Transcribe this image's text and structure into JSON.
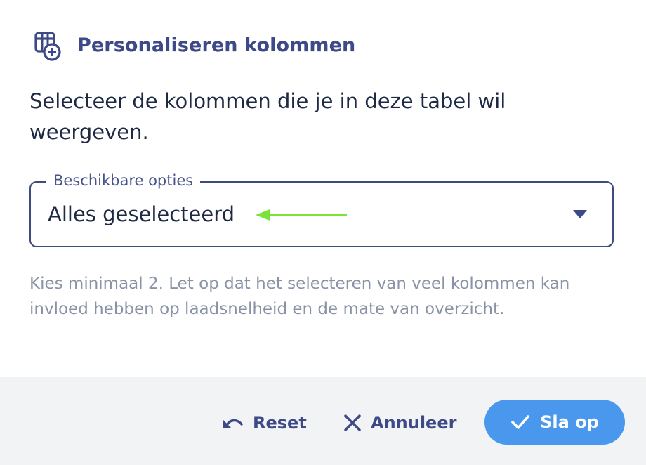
{
  "dialog": {
    "title": "Personaliseren kolommen",
    "title_icon": "table-add-icon",
    "description": "Selecteer de kolommen die je in deze tabel wil weergeven."
  },
  "select": {
    "legend": "Beschikbare opties",
    "value": "Alles geselecteerd",
    "caret_icon": "caret-down-icon",
    "annotation_color": "#7be23a"
  },
  "helper_text": "Kies minimaal 2. Let op dat het selecteren van veel kolommen kan invloed hebben op laadsnelheid en de mate van overzicht.",
  "footer": {
    "reset_label": "Reset",
    "reset_icon": "undo-icon",
    "cancel_label": "Annuleer",
    "cancel_icon": "close-icon",
    "save_label": "Sla op",
    "save_icon": "check-icon"
  },
  "colors": {
    "primary_text": "#3d4a87",
    "save_button": "#4a97ee",
    "footer_bg": "#f2f3f5"
  }
}
